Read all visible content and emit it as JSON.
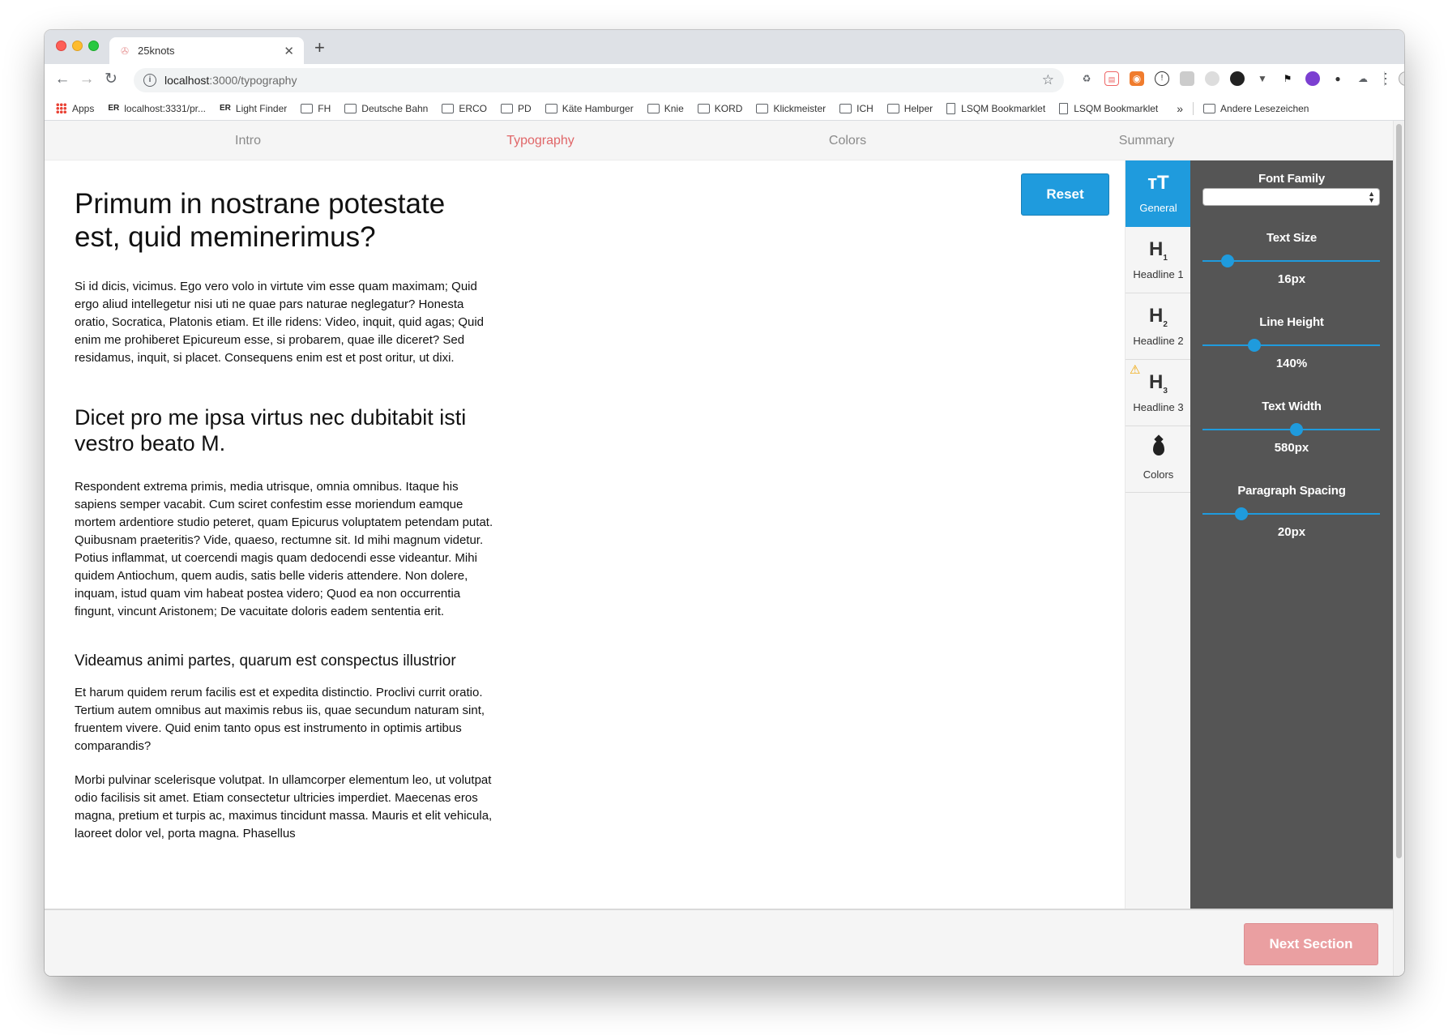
{
  "browser": {
    "tab_title": "25knots",
    "url_host": "localhost",
    "url_path": ":3000/typography",
    "bookmarks": [
      {
        "label": "Apps",
        "icon": "apps-grid-icon"
      },
      {
        "label": "localhost:3331/pr...",
        "icon": "er-icon"
      },
      {
        "label": "Light Finder",
        "icon": "er-icon"
      },
      {
        "label": "FH",
        "icon": "folder-icon"
      },
      {
        "label": "Deutsche Bahn",
        "icon": "folder-icon"
      },
      {
        "label": "ERCO",
        "icon": "folder-icon"
      },
      {
        "label": "PD",
        "icon": "folder-icon"
      },
      {
        "label": "Käte Hamburger",
        "icon": "folder-icon"
      },
      {
        "label": "Knie",
        "icon": "folder-icon"
      },
      {
        "label": "KORD",
        "icon": "folder-icon"
      },
      {
        "label": "Klickmeister",
        "icon": "folder-icon"
      },
      {
        "label": "ICH",
        "icon": "folder-icon"
      },
      {
        "label": "Helper",
        "icon": "folder-icon"
      },
      {
        "label": "LSQM Bookmarklet",
        "icon": "document-icon"
      },
      {
        "label": "LSQM Bookmarklet",
        "icon": "document-icon"
      }
    ],
    "bookmarks_more": "»",
    "other_bookmarks": "Andere Lesezeichen"
  },
  "section_nav": {
    "items": [
      "Intro",
      "Typography",
      "Colors",
      "Summary"
    ],
    "active": "Typography"
  },
  "reset_label": "Reset",
  "content": {
    "h1": "Primum in nostrane potestate est, quid meminerimus?",
    "p1": "Si id dicis, vicimus. Ego vero volo in virtute vim esse quam maximam; Quid ergo aliud intellegetur nisi uti ne quae pars naturae neglegatur? Honesta oratio, Socratica, Platonis etiam. Et ille ridens: Video, inquit, quid agas; Quid enim me prohiberet Epicureum esse, si probarem, quae ille diceret? Sed residamus, inquit, si placet. Consequens enim est et post oritur, ut dixi.",
    "h2": "Dicet pro me ipsa virtus nec dubitabit isti vestro beato M.",
    "p2": "Respondent extrema primis, media utrisque, omnia omnibus. Itaque his sapiens semper vacabit. Cum sciret confestim esse moriendum eamque mortem ardentiore studio peteret, quam Epicurus voluptatem petendam putat. Quibusnam praeteritis? Vide, quaeso, rectumne sit. Id mihi magnum videtur. Potius inflammat, ut coercendi magis quam dedocendi esse videantur. Mihi quidem Antiochum, quem audis, satis belle videris attendere. Non dolere, inquam, istud quam vim habeat postea videro; Quod ea non occurrentia fingunt, vincunt Aristonem; De vacuitate doloris eadem sententia erit.",
    "h3": "Videamus animi partes, quarum est conspectus illustrior",
    "p3": "Et harum quidem rerum facilis est et expedita distinctio. Proclivi currit oratio. Tertium autem omnibus aut maximis rebus iis, quae secundum naturam sint, fruentem vivere. Quid enim tanto opus est instrumento in optimis artibus comparandis?",
    "p4": "Morbi pulvinar scelerisque volutpat. In ullamcorper elementum leo, ut volutpat odio facilisis sit amet. Etiam consectetur ultricies imperdiet. Maecenas eros magna, pretium et turpis ac, maximus tincidunt massa. Mauris et elit vehicula, laoreet dolor vel, porta magna. Phasellus"
  },
  "side_tabs": [
    {
      "label": "General",
      "glyph": "тT",
      "sub": "",
      "active": true,
      "warning": false
    },
    {
      "label": "Headline 1",
      "glyph": "H",
      "sub": "1",
      "active": false,
      "warning": false
    },
    {
      "label": "Headline 2",
      "glyph": "H",
      "sub": "2",
      "active": false,
      "warning": false
    },
    {
      "label": "Headline 3",
      "glyph": "H",
      "sub": "3",
      "active": false,
      "warning": true
    },
    {
      "label": "Colors",
      "glyph": "",
      "sub": "",
      "active": false,
      "warning": false
    }
  ],
  "settings": {
    "font_family_label": "Font Family",
    "font_family_value": "",
    "text_size": {
      "label": "Text Size",
      "value": "16px",
      "slider_fraction": 0.14
    },
    "line_height": {
      "label": "Line Height",
      "value": "140%",
      "slider_fraction": 0.29
    },
    "text_width": {
      "label": "Text Width",
      "value": "580px",
      "slider_fraction": 0.53
    },
    "paragraph_spacing": {
      "label": "Paragraph Spacing",
      "value": "20px",
      "slider_fraction": 0.22
    }
  },
  "next_label": "Next Section",
  "colors": {
    "accent": "#1f9bdd",
    "active_nav": "#e06668",
    "next_button": "#ea9fa1",
    "panel": "#555555"
  }
}
